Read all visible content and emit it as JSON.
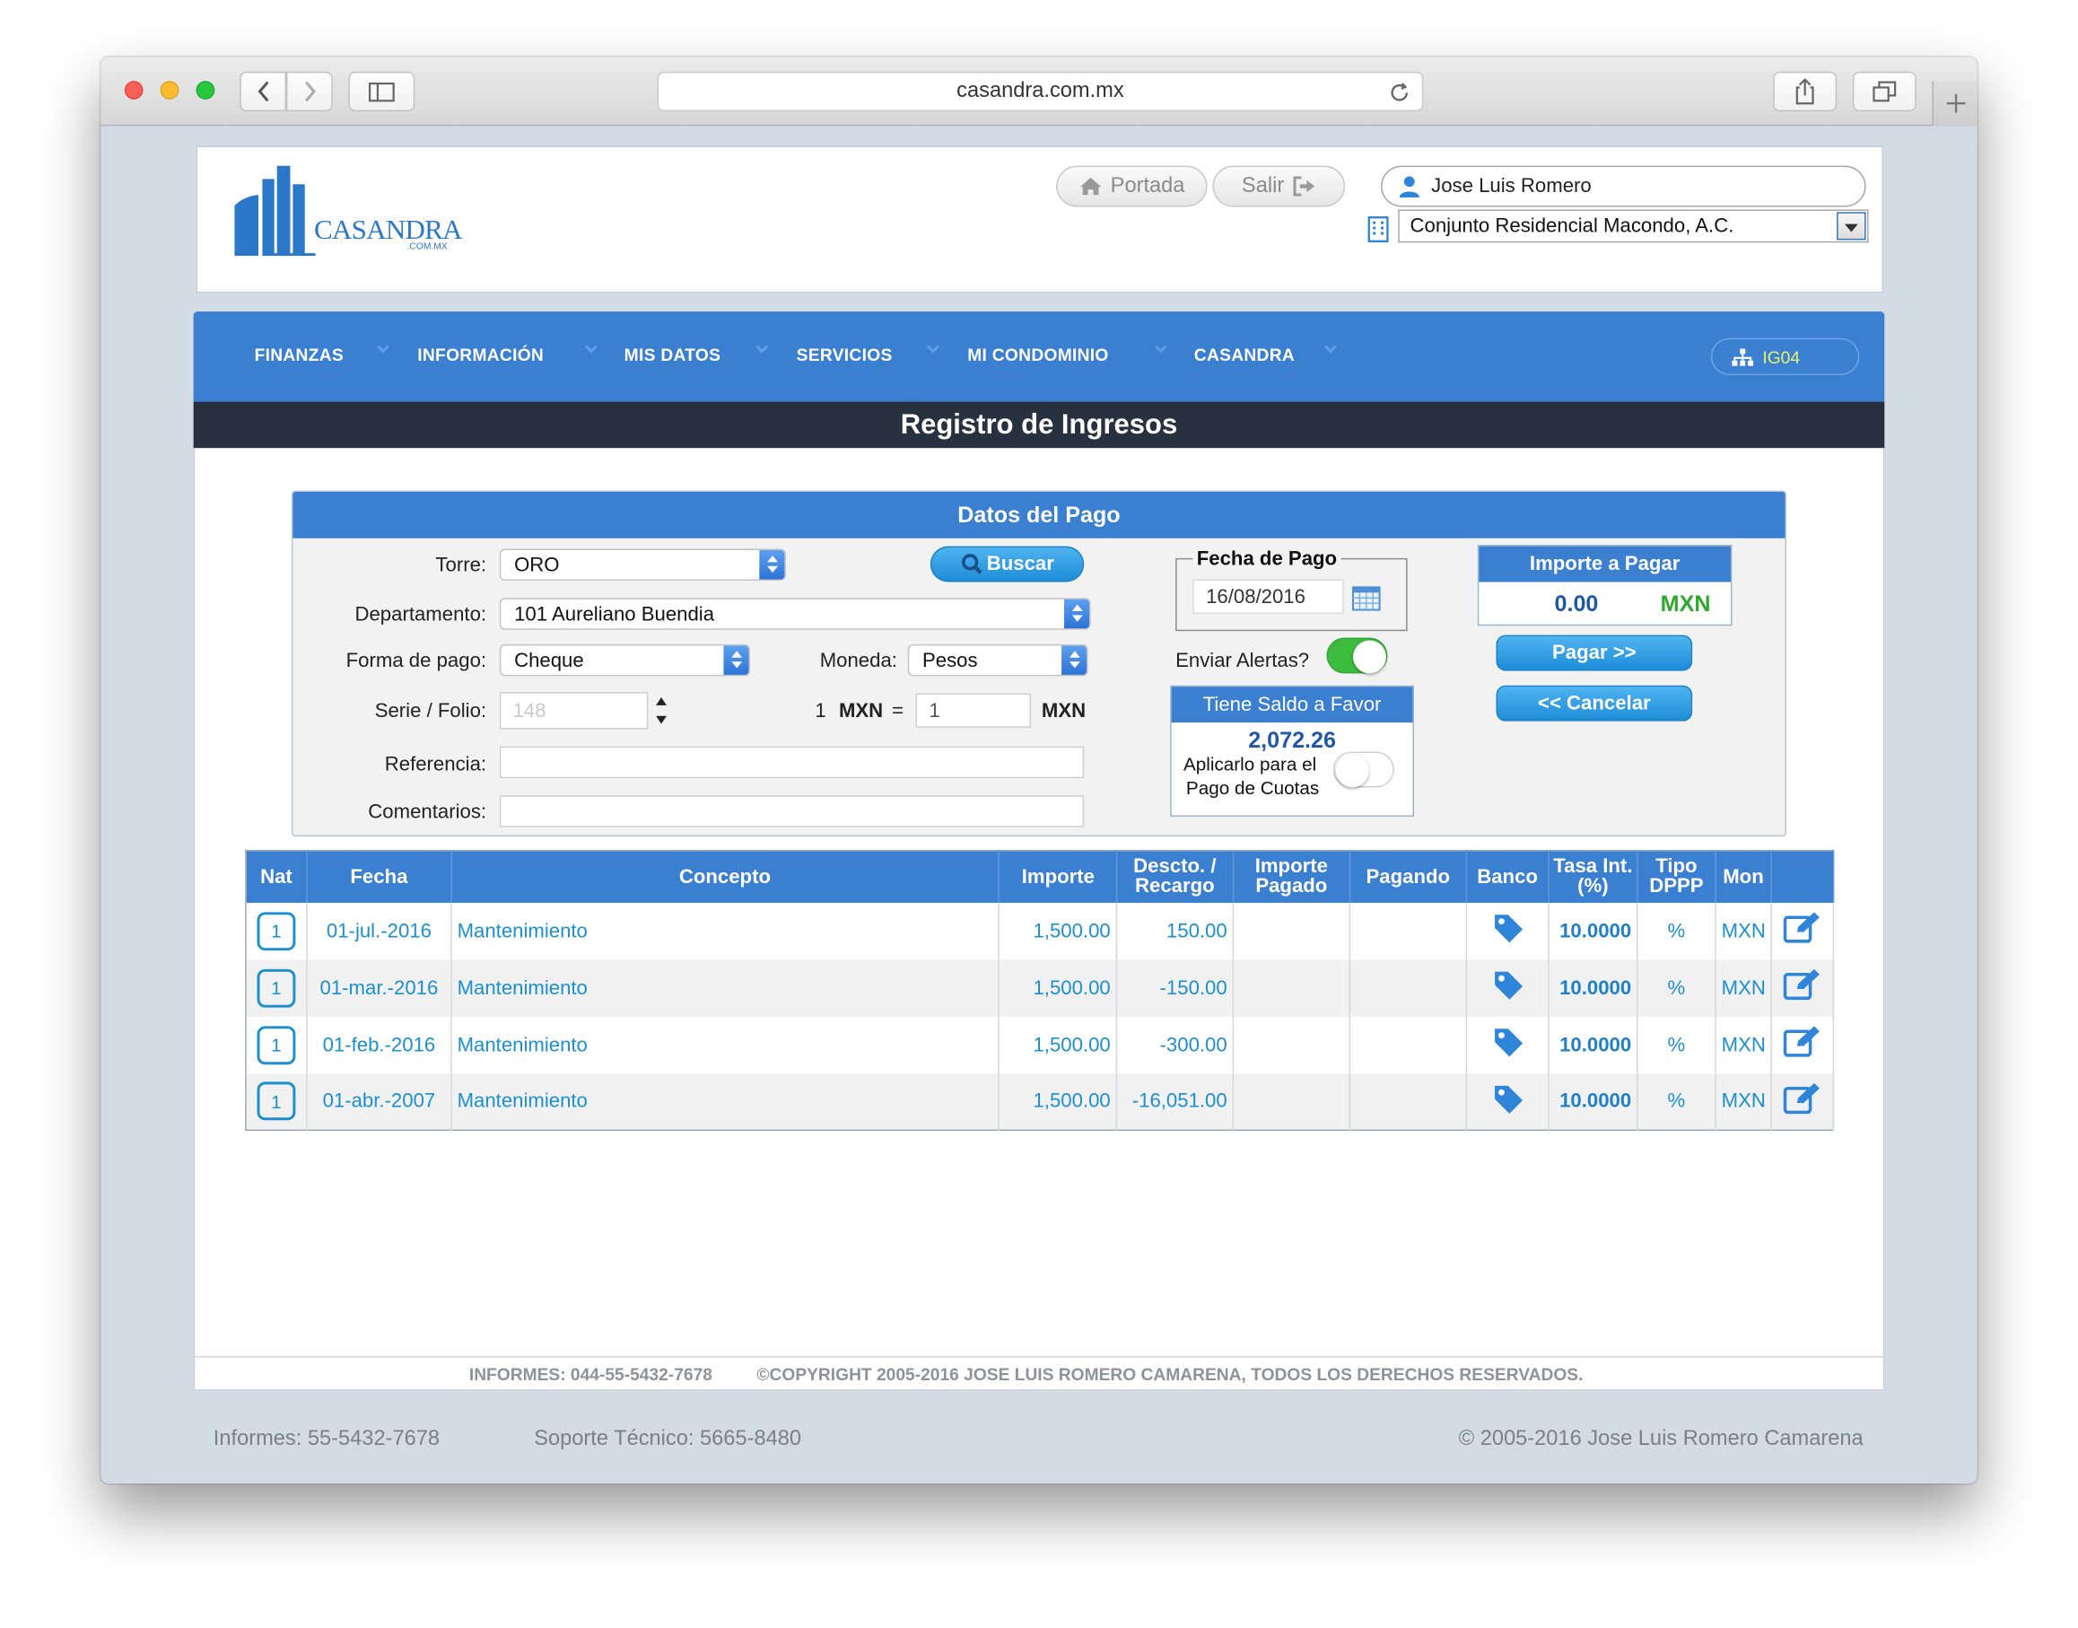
{
  "browser": {
    "url": "casandra.com.mx"
  },
  "header": {
    "logo_text": "CASANDRA",
    "logo_sub": ".COM.MX",
    "portada_label": "Portada",
    "salir_label": "Salir",
    "user_name": "Jose Luis Romero",
    "condominio": "Conjunto Residencial Macondo, A.C."
  },
  "nav": {
    "items": [
      "FINANZAS",
      "INFORMACIÓN",
      "MIS DATOS",
      "SERVICIOS",
      "MI CONDOMINIO",
      "CASANDRA"
    ],
    "code": "IG04"
  },
  "page_title": "Registro de Ingresos",
  "panel": {
    "title": "Datos del Pago",
    "torre_label": "Torre:",
    "torre_value": "ORO",
    "buscar_label": "Buscar",
    "departamento_label": "Departamento:",
    "departamento_value": "101 Aureliano Buendia",
    "forma_pago_label": "Forma de pago:",
    "forma_pago_value": "Cheque",
    "moneda_label": "Moneda:",
    "moneda_value": "Pesos",
    "serie_label": "Serie / Folio:",
    "serie_placeholder": "148",
    "rate_qty": "1",
    "rate_cur_from": "MXN",
    "rate_eq": "=",
    "rate_value": "1",
    "rate_cur_to": "MXN",
    "referencia_label": "Referencia:",
    "comentarios_label": "Comentarios:",
    "fecha_label": "Fecha de Pago",
    "fecha_value": "16/08/2016",
    "alertas_label": "Enviar Alertas?",
    "alertas_on": true,
    "saldo_title": "Tiene Saldo a Favor",
    "saldo_amount": "2,072.26",
    "saldo_apply_1": "Aplicarlo para el",
    "saldo_apply_2": "Pago de Cuotas",
    "importe_title": "Importe a Pagar",
    "importe_amount": "0.00",
    "importe_currency": "MXN",
    "pagar_label": "Pagar >>",
    "cancelar_label": "<< Cancelar"
  },
  "table": {
    "headers": [
      "Nat",
      "Fecha",
      "Concepto",
      "Importe",
      "Descto. / Recargo",
      "Importe Pagado",
      "Pagando",
      "Banco",
      "Tasa Int. (%)",
      "Tipo DPPP",
      "Mon",
      ""
    ],
    "rows": [
      {
        "nat": "1",
        "fecha": "01-jul.-2016",
        "concepto": "Mantenimiento",
        "importe": "1,500.00",
        "descto": "150.00",
        "pagado": "",
        "pagando": "",
        "tasa": "10.0000",
        "tipo": "%",
        "mon": "MXN"
      },
      {
        "nat": "1",
        "fecha": "01-mar.-2016",
        "concepto": "Mantenimiento",
        "importe": "1,500.00",
        "descto": "-150.00",
        "pagado": "",
        "pagando": "",
        "tasa": "10.0000",
        "tipo": "%",
        "mon": "MXN"
      },
      {
        "nat": "1",
        "fecha": "01-feb.-2016",
        "concepto": "Mantenimiento",
        "importe": "1,500.00",
        "descto": "-300.00",
        "pagado": "",
        "pagando": "",
        "tasa": "10.0000",
        "tipo": "%",
        "mon": "MXN"
      },
      {
        "nat": "1",
        "fecha": "01-abr.-2007",
        "concepto": "Mantenimiento",
        "importe": "1,500.00",
        "descto": "-16,051.00",
        "pagado": "",
        "pagando": "",
        "tasa": "10.0000",
        "tipo": "%",
        "mon": "MXN"
      }
    ]
  },
  "footer": {
    "informes_bar": "INFORMES: 044-55-5432-7678",
    "copyright_bar": "©COPYRIGHT 2005-2016 JOSE LUIS ROMERO CAMARENA, TODOS LOS DERECHOS RESERVADOS.",
    "informes": "Informes: 55-5432-7678",
    "soporte": "Soporte Técnico: 5665-8480",
    "copyright": "© 2005-2016 Jose Luis Romero Camarena"
  },
  "colors": {
    "accent": "#3b7fd1",
    "title_bar": "#27313f",
    "link": "#1c8fd0",
    "toggle_on": "#3dbb3d",
    "currency_green": "#2fa82f"
  }
}
